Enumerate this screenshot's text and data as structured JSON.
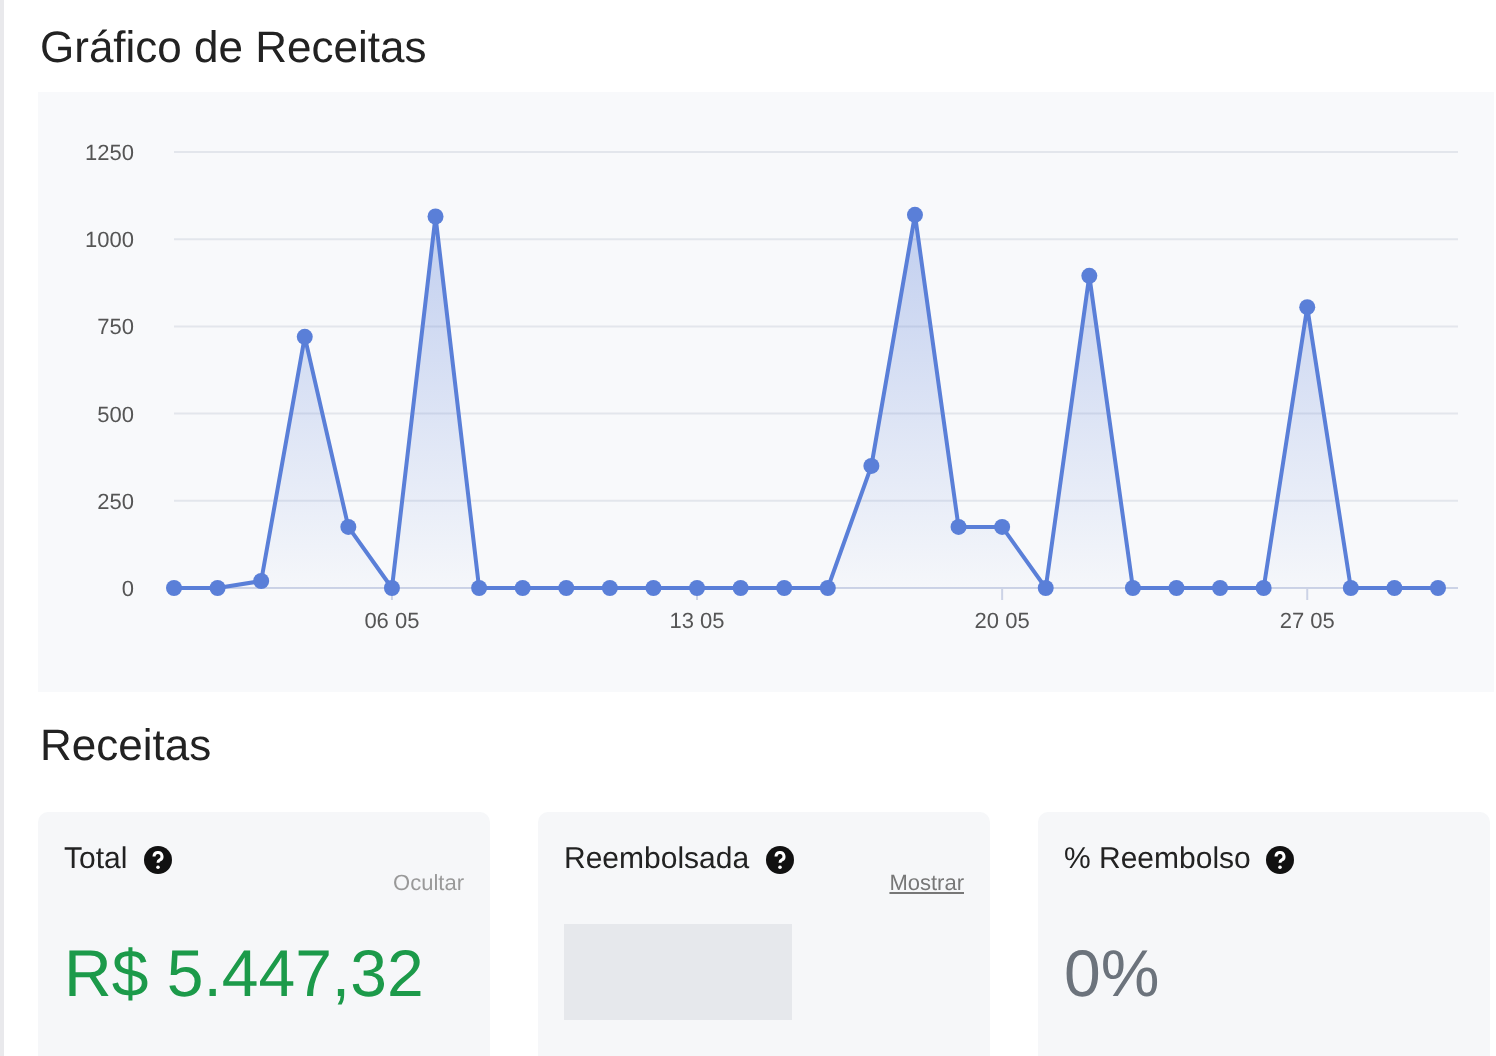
{
  "chart_section": {
    "title": "Gráfico de Receitas",
    "chart_data": {
      "type": "area",
      "grid": true,
      "categories": [
        null,
        null,
        null,
        null,
        null,
        "06 05",
        null,
        null,
        null,
        null,
        null,
        null,
        "13 05",
        null,
        null,
        null,
        null,
        null,
        null,
        "20 05",
        null,
        null,
        null,
        null,
        null,
        null,
        "27 05",
        null,
        null,
        null
      ],
      "series": [
        {
          "color": "#5a7fd8",
          "values": [
            0,
            0,
            20,
            720,
            175,
            0,
            1065,
            0,
            0,
            0,
            0,
            0,
            0,
            0,
            0,
            0,
            350,
            1070,
            175,
            175,
            0,
            895,
            0,
            0,
            0,
            0,
            805,
            0,
            0,
            0
          ]
        }
      ],
      "ylim": [
        0,
        1250
      ],
      "yticks": [
        0,
        250,
        500,
        750,
        1000,
        1250
      ]
    }
  },
  "summary": {
    "title": "Receitas",
    "cards": [
      {
        "label": "Total",
        "kind": "money",
        "action": "Ocultar",
        "value": "R$ 5.447,32"
      },
      {
        "label": "Reembolsada",
        "kind": "hidden",
        "action": "Mostrar"
      },
      {
        "label": "% Reembolso",
        "kind": "percent",
        "value": "0%"
      }
    ]
  }
}
